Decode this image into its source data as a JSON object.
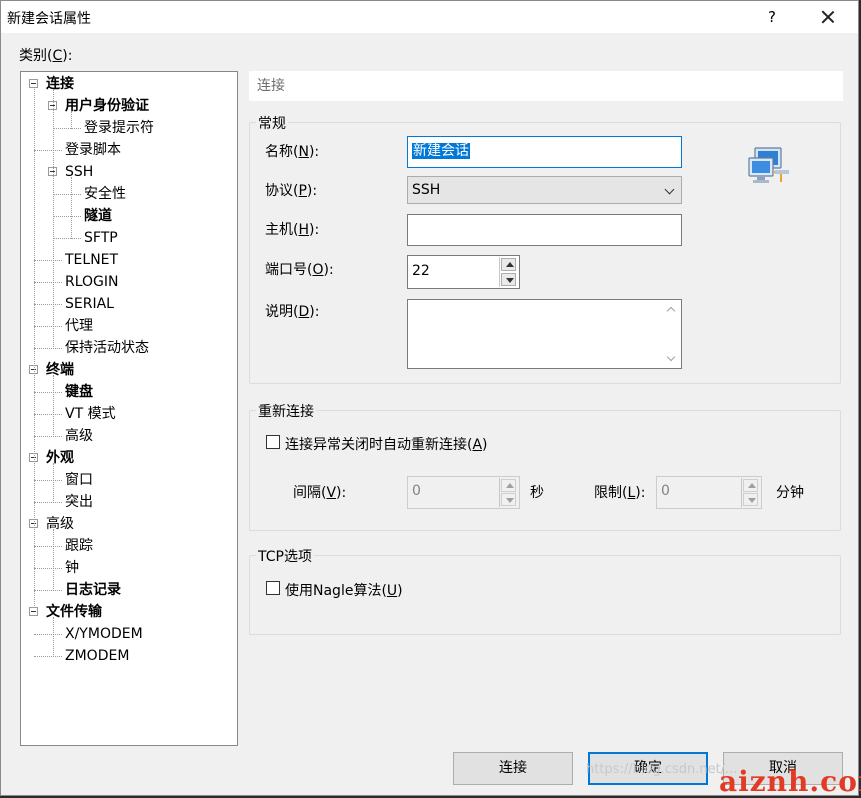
{
  "window": {
    "title": "新建会话属性",
    "help_label": "?",
    "close_label": "×"
  },
  "category": {
    "label": "类别(C):",
    "label_prefix": "类别(",
    "label_key": "C",
    "label_suffix": "):"
  },
  "tree": [
    {
      "label": "连接",
      "level": 0,
      "bold": true,
      "expander": true
    },
    {
      "label": "用户身份验证",
      "level": 1,
      "bold": true,
      "expander": true
    },
    {
      "label": "登录提示符",
      "level": 2,
      "bold": false
    },
    {
      "label": "登录脚本",
      "level": 1,
      "bold": false
    },
    {
      "label": "SSH",
      "level": 1,
      "bold": false,
      "expander": true
    },
    {
      "label": "安全性",
      "level": 2,
      "bold": false
    },
    {
      "label": "隧道",
      "level": 2,
      "bold": true
    },
    {
      "label": "SFTP",
      "level": 2,
      "bold": false
    },
    {
      "label": "TELNET",
      "level": 1,
      "bold": false
    },
    {
      "label": "RLOGIN",
      "level": 1,
      "bold": false
    },
    {
      "label": "SERIAL",
      "level": 1,
      "bold": false
    },
    {
      "label": "代理",
      "level": 1,
      "bold": false
    },
    {
      "label": "保持活动状态",
      "level": 1,
      "bold": false
    },
    {
      "label": "终端",
      "level": 0,
      "bold": true,
      "expander": true
    },
    {
      "label": "键盘",
      "level": 1,
      "bold": true
    },
    {
      "label": "VT 模式",
      "level": 1,
      "bold": false
    },
    {
      "label": "高级",
      "level": 1,
      "bold": false
    },
    {
      "label": "外观",
      "level": 0,
      "bold": true,
      "expander": true
    },
    {
      "label": "窗口",
      "level": 1,
      "bold": false
    },
    {
      "label": "突出",
      "level": 1,
      "bold": false
    },
    {
      "label": "高级",
      "level": 0,
      "bold": false,
      "expander": true
    },
    {
      "label": "跟踪",
      "level": 1,
      "bold": false
    },
    {
      "label": "钟",
      "level": 1,
      "bold": false
    },
    {
      "label": "日志记录",
      "level": 1,
      "bold": true
    },
    {
      "label": "文件传输",
      "level": 0,
      "bold": true,
      "expander": true
    },
    {
      "label": "X/YMODEM",
      "level": 1,
      "bold": false
    },
    {
      "label": "ZMODEM",
      "level": 1,
      "bold": false
    }
  ],
  "panel": {
    "header": "连接",
    "general": {
      "title": "常规",
      "name_label_pre": "名称(",
      "name_label_key": "N",
      "name_label_post": "):",
      "name_value": "新建会话",
      "protocol_label_pre": "协议(",
      "protocol_label_key": "P",
      "protocol_label_post": "):",
      "protocol_value": "SSH",
      "host_label_pre": "主机(",
      "host_label_key": "H",
      "host_label_post": "):",
      "host_value": "",
      "port_label_pre": "端口号(",
      "port_label_key": "O",
      "port_label_post": "):",
      "port_value": "22",
      "desc_label_pre": "说明(",
      "desc_label_key": "D",
      "desc_label_post": "):",
      "desc_value": ""
    },
    "reconnect": {
      "title": "重新连接",
      "auto_label_pre": "连接异常关闭时自动重新连接(",
      "auto_label_key": "A",
      "auto_label_post": ")",
      "interval_label_pre": "间隔(",
      "interval_label_key": "V",
      "interval_label_post": "):",
      "interval_value": "0",
      "interval_unit": "秒",
      "limit_label_pre": "限制(",
      "limit_label_key": "L",
      "limit_label_post": "):",
      "limit_value": "0",
      "limit_unit": "分钟"
    },
    "tcp": {
      "title": "TCP选项",
      "nagle_label_pre": "使用Nagle算法(",
      "nagle_label_key": "U",
      "nagle_label_post": ")"
    }
  },
  "buttons": {
    "connect": "连接",
    "ok": "确定",
    "cancel": "取消"
  },
  "watermark": {
    "url": "https://blog.csdn.net/...",
    "brand": "aiznh.com"
  },
  "colors": {
    "accent": "#0078d7",
    "watermark_brand": "#e33a25"
  },
  "icons": {
    "session_icon": "network-computers-icon"
  }
}
